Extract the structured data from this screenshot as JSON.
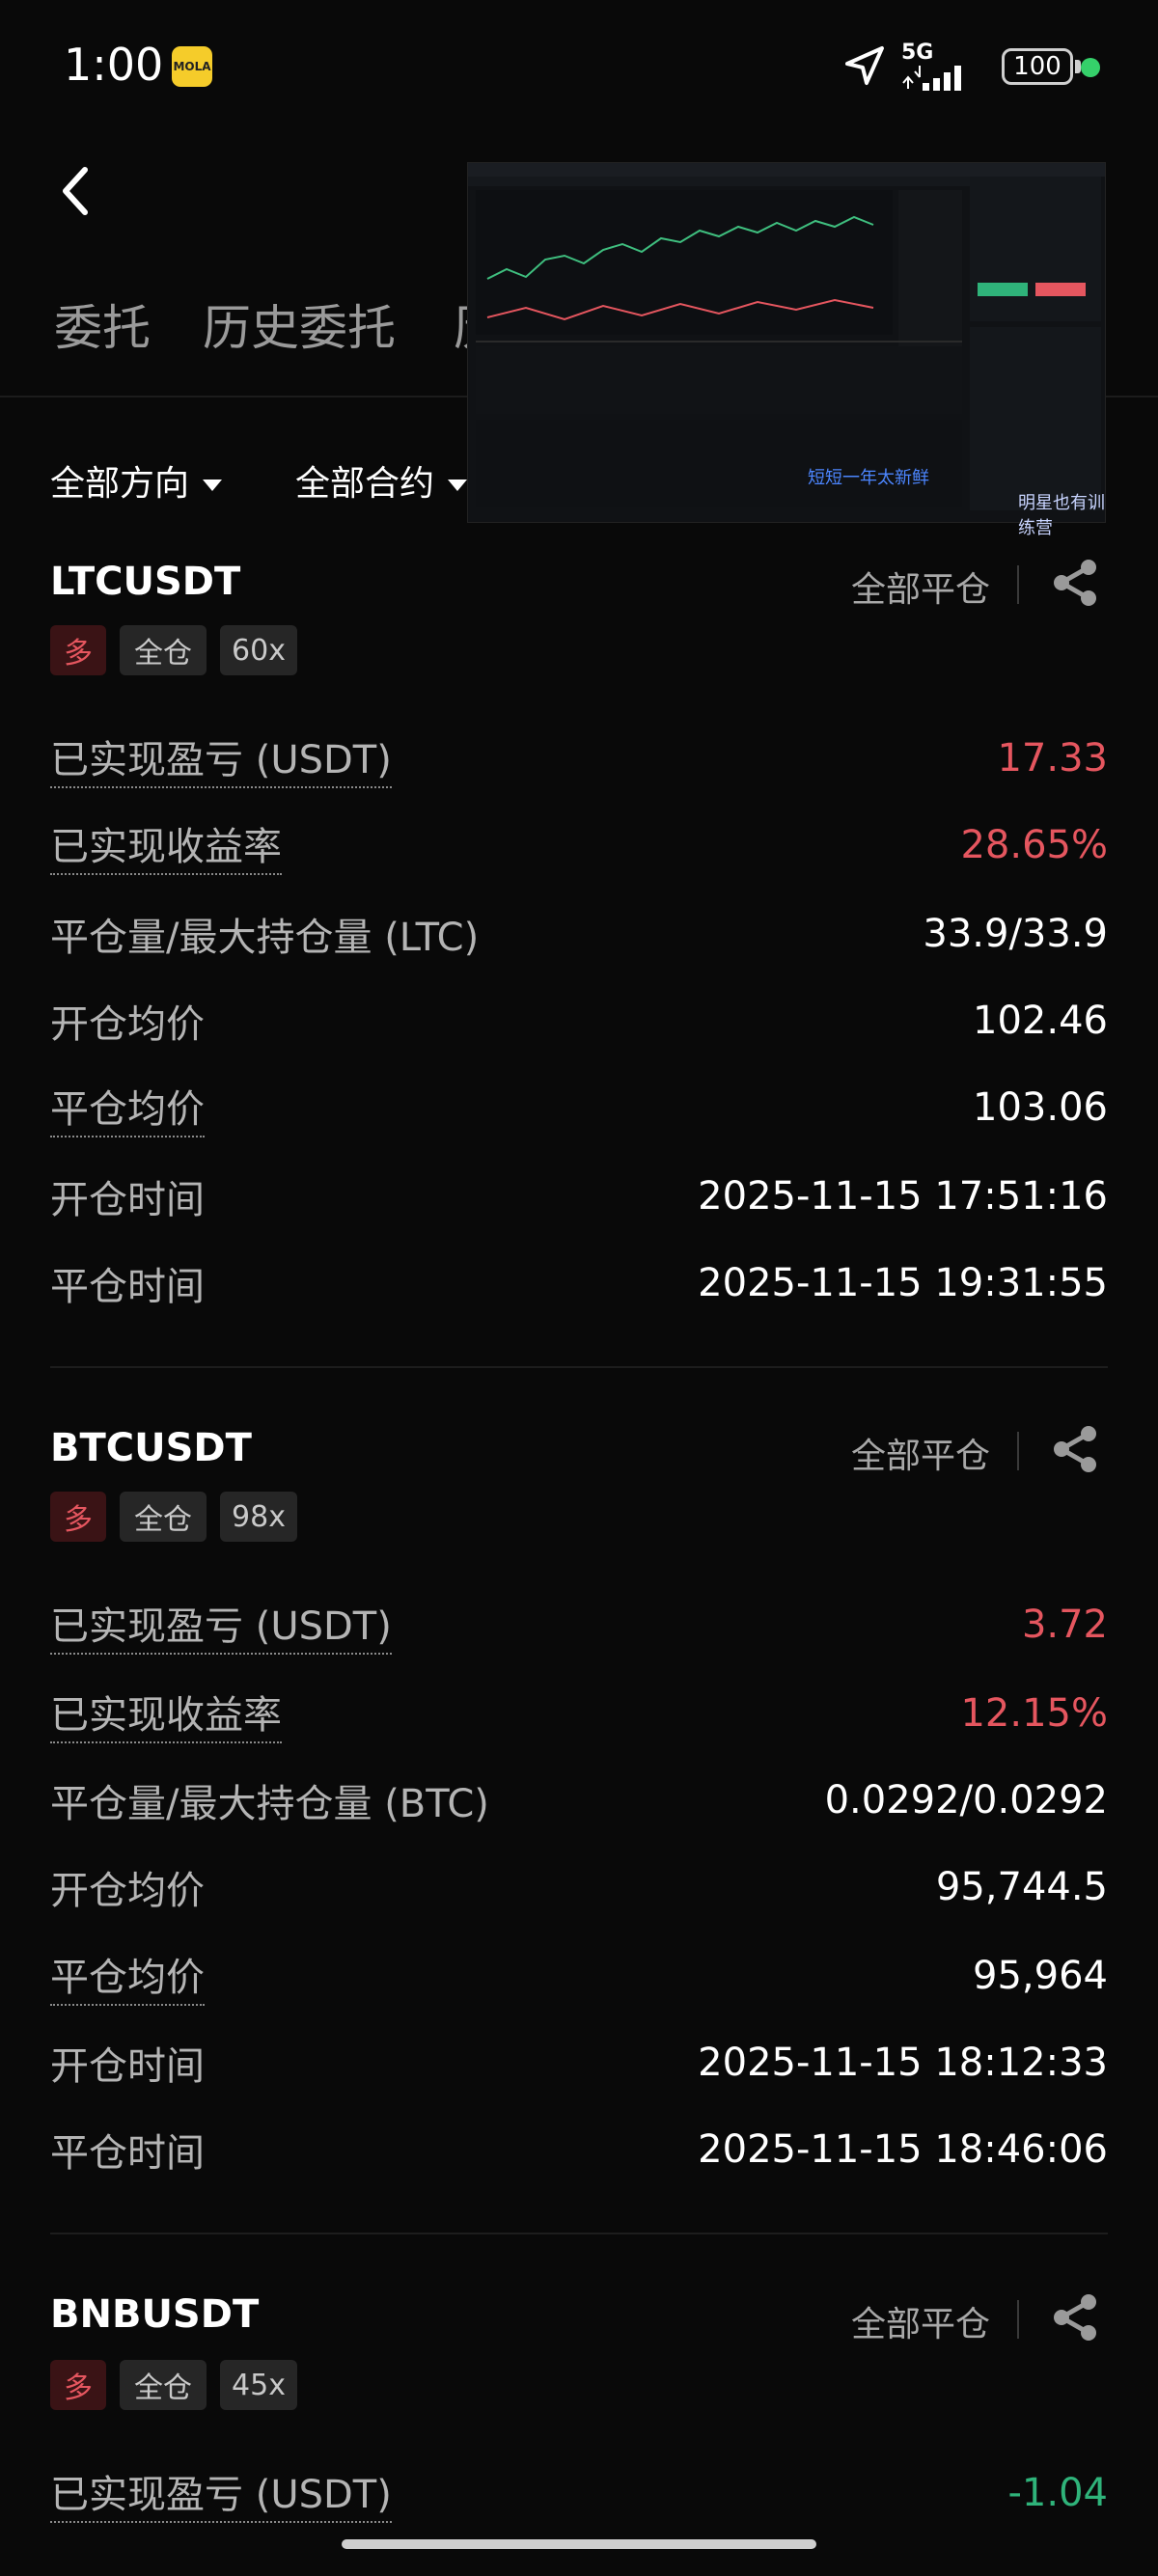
{
  "status": {
    "time": "1:00",
    "app_badge": "MOLA",
    "network": "5G",
    "battery": "100"
  },
  "tabs": [
    "委托",
    "历史委托",
    "历"
  ],
  "filters": {
    "direction": "全部方向",
    "contract": "全部合约"
  },
  "overlay": {
    "caption": "短短一年太新鲜",
    "brand": "明星也有训练营"
  },
  "labels": {
    "close_all": "全部平仓",
    "pnl": "已实现盈亏 (USDT)",
    "roi": "已实现收益率",
    "open_price": "开仓均价",
    "close_price": "平仓均价",
    "open_time": "开仓时间",
    "close_time": "平仓时间"
  },
  "positions": [
    {
      "symbol": "LTCUSDT",
      "side": "多",
      "margin": "全仓",
      "leverage": "60x",
      "pnl": "17.33",
      "roi": "28.65%",
      "qty_label": "平仓量/最大持仓量 (LTC)",
      "qty": "33.9/33.9",
      "open_price": "102.46",
      "close_price": "103.06",
      "open_time": "2025-11-15 17:51:16",
      "close_time": "2025-11-15 19:31:55"
    },
    {
      "symbol": "BTCUSDT",
      "side": "多",
      "margin": "全仓",
      "leverage": "98x",
      "pnl": "3.72",
      "roi": "12.15%",
      "qty_label": "平仓量/最大持仓量 (BTC)",
      "qty": "0.0292/0.0292",
      "open_price": "95,744.5",
      "close_price": "95,964",
      "open_time": "2025-11-15 18:12:33",
      "close_time": "2025-11-15 18:46:06"
    },
    {
      "symbol": "BNBUSDT",
      "side": "多",
      "margin": "全仓",
      "leverage": "45x",
      "pnl": "-1.04"
    }
  ],
  "colors": {
    "profit": "#e5565f",
    "loss": "#2fb37a",
    "background": "#090909"
  }
}
